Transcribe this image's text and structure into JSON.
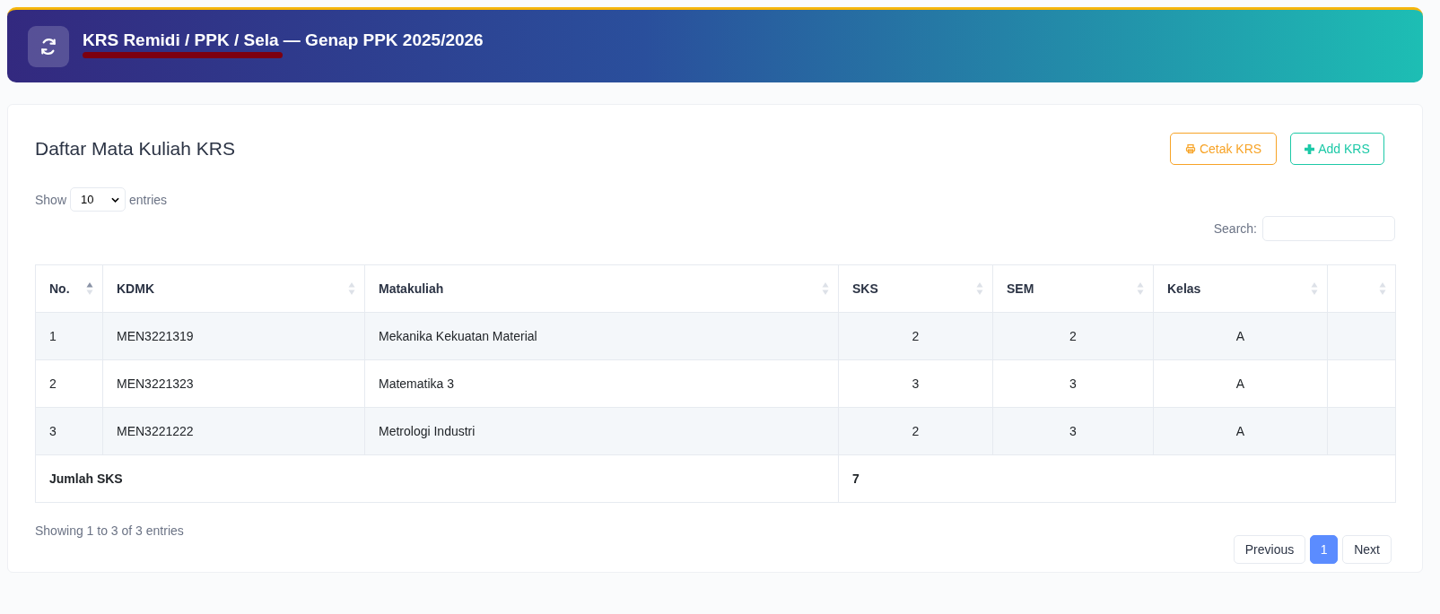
{
  "header": {
    "title": "KRS Remidi / PPK / Sela — Genap PPK 2025/2026",
    "subtitle_redacted": true
  },
  "card": {
    "title": "Daftar Mata Kuliah KRS",
    "buttons": [
      {
        "kind": "print",
        "label": "Cetak KRS"
      },
      {
        "kind": "add",
        "label": "Add KRS"
      }
    ]
  },
  "length": {
    "before": "Show",
    "value": "10",
    "after": "entries"
  },
  "search": {
    "label": "Search:"
  },
  "table": {
    "columns": [
      {
        "label": "No.",
        "sorted": true
      },
      {
        "label": "KDMK",
        "sorted": false
      },
      {
        "label": "Matakuliah",
        "sorted": false
      },
      {
        "label": "SKS",
        "sorted": false
      },
      {
        "label": "SEM",
        "sorted": false
      },
      {
        "label": "Kelas",
        "sorted": false
      },
      {
        "sorted": false
      }
    ],
    "rows": [
      [
        "1",
        "MEN3221319",
        "Mekanika Kekuatan Material",
        "2",
        "2",
        "A"
      ],
      [
        "2",
        "MEN3221323",
        "Matematika 3",
        "3",
        "3",
        "A"
      ],
      [
        "3",
        "MEN3221222",
        "Metrologi Industri",
        "2",
        "3",
        "A"
      ]
    ],
    "footer": {
      "label": "Jumlah SKS",
      "total": "7"
    }
  },
  "info": "Showing 1 to 3 of 3 entries",
  "pagination": [
    {
      "label": "Previous",
      "selected": false
    },
    {
      "label": "1",
      "selected": true
    },
    {
      "label": "Next",
      "selected": false
    }
  ]
}
